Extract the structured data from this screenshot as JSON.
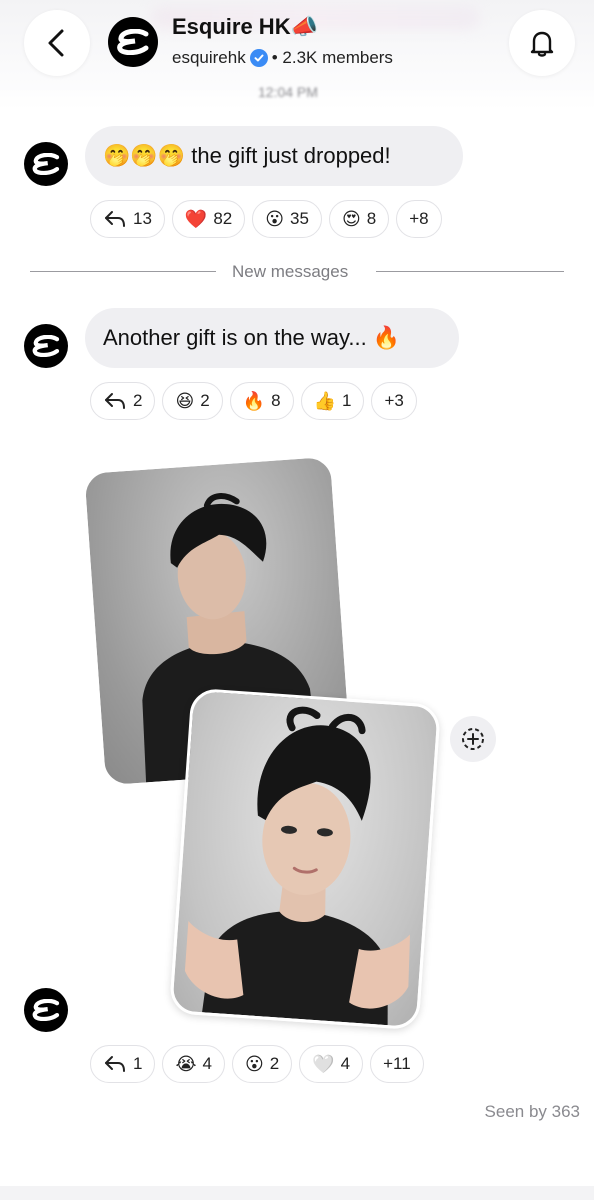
{
  "header": {
    "title": "Esquire HK",
    "title_emoji": "📣",
    "handle": "esquirehk",
    "members": "• 2.3K members",
    "timestamp": "12:04 PM",
    "icons": {
      "back": "chevron-left-icon",
      "bell": "bell-icon",
      "verified": "verified-badge-icon"
    }
  },
  "messages": [
    {
      "text": "🤭🤭🤭 the gift just dropped!",
      "reactions": [
        {
          "emoji": "↩",
          "count": "13"
        },
        {
          "emoji": "❤️",
          "count": "82"
        },
        {
          "emoji": "😮",
          "count": "35"
        },
        {
          "emoji": "😍",
          "count": "8"
        },
        {
          "emoji": "",
          "count": "+8"
        }
      ]
    },
    {
      "text": "Another gift is on the way... 🔥",
      "reactions": [
        {
          "emoji": "↩",
          "count": "2"
        },
        {
          "emoji": "😆",
          "count": "2"
        },
        {
          "emoji": "🔥",
          "count": "8"
        },
        {
          "emoji": "👍",
          "count": "1"
        },
        {
          "emoji": "",
          "count": "+3"
        }
      ]
    },
    {
      "reactions": [
        {
          "emoji": "↩",
          "count": "1"
        },
        {
          "emoji": "😭",
          "count": "4"
        },
        {
          "emoji": "😮",
          "count": "2"
        },
        {
          "emoji": "🤍",
          "count": "4"
        },
        {
          "emoji": "",
          "count": "+11"
        }
      ]
    }
  ],
  "divider_label": "New messages",
  "seen": "Seen by 363",
  "colors": {
    "bubble": "#efeff2",
    "verified": "#3a8bf5",
    "logo": "#000000"
  }
}
